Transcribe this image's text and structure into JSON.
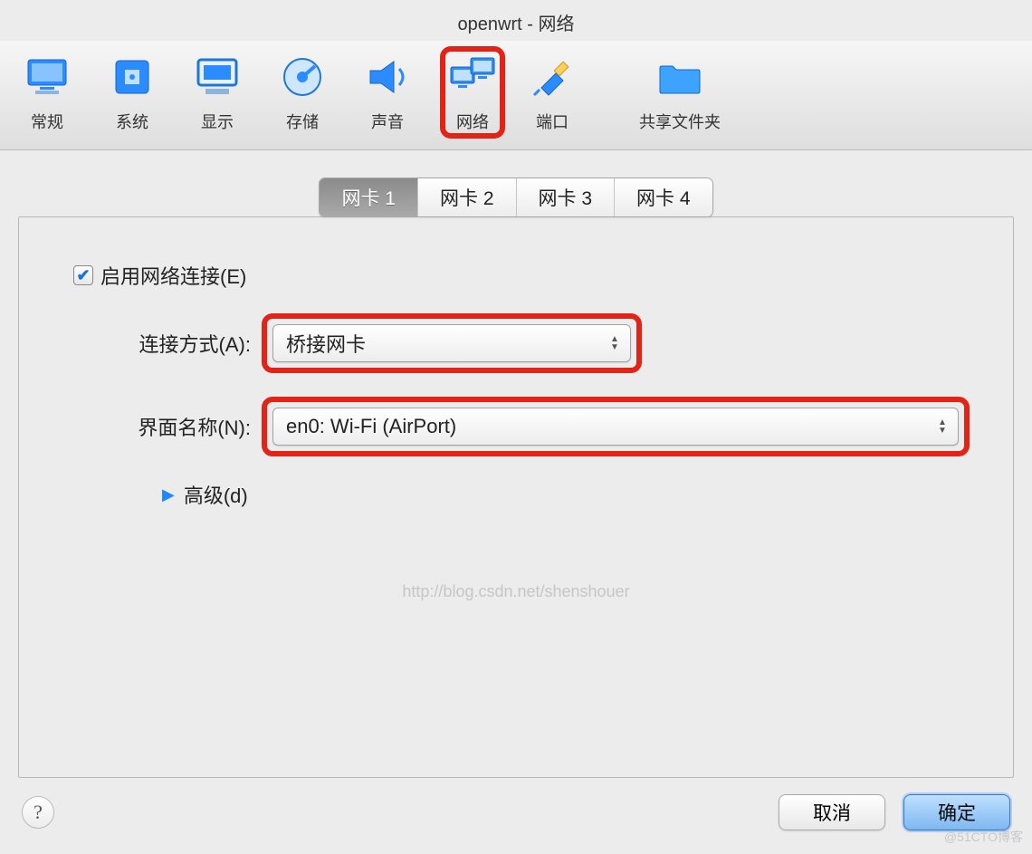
{
  "window": {
    "title": "openwrt - 网络"
  },
  "toolbar": {
    "items": [
      {
        "name": "general",
        "label": "常规",
        "icon": "monitor-icon"
      },
      {
        "name": "system",
        "label": "系统",
        "icon": "chip-icon"
      },
      {
        "name": "display",
        "label": "显示",
        "icon": "display-icon"
      },
      {
        "name": "storage",
        "label": "存储",
        "icon": "disk-icon"
      },
      {
        "name": "sound",
        "label": "声音",
        "icon": "speaker-icon"
      },
      {
        "name": "network",
        "label": "网络",
        "icon": "network-icon",
        "highlighted": true
      },
      {
        "name": "port",
        "label": "端口",
        "icon": "plug-icon"
      },
      {
        "name": "shared",
        "label": "共享文件夹",
        "icon": "folder-icon"
      }
    ]
  },
  "tabs": {
    "items": [
      {
        "label": "网卡 1",
        "active": true
      },
      {
        "label": "网卡 2"
      },
      {
        "label": "网卡 3"
      },
      {
        "label": "网卡 4"
      }
    ]
  },
  "form": {
    "enable_label": "启用网络连接(E)",
    "enable_checked": true,
    "attach_label": "连接方式(A):",
    "attach_value": "桥接网卡",
    "iface_label": "界面名称(N):",
    "iface_value": "en0: Wi-Fi (AirPort)",
    "advanced_label": "高级(d)"
  },
  "watermark": "http://blog.csdn.net/shenshouer",
  "footer": {
    "cancel": "取消",
    "ok": "确定",
    "corner": "@51CTO博客"
  }
}
